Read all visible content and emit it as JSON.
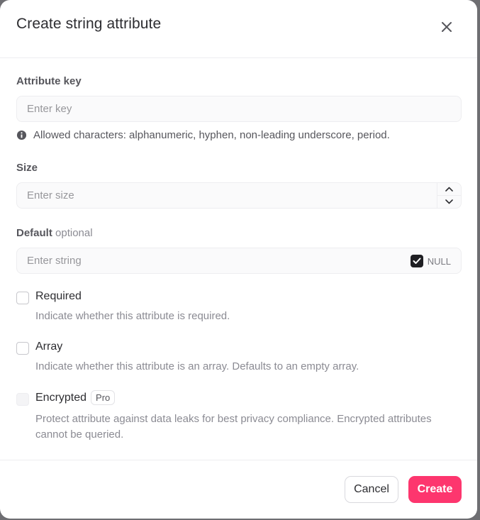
{
  "modal": {
    "title": "Create string attribute",
    "close_icon": "close-icon"
  },
  "key_field": {
    "label": "Attribute key",
    "placeholder": "Enter key",
    "value": "",
    "hint_icon": "info-icon",
    "hint": "Allowed characters: alphanumeric, hyphen, non-leading underscore, period."
  },
  "size_field": {
    "label": "Size",
    "placeholder": "Enter size",
    "value": "",
    "increment_icon": "chevron-up-icon",
    "decrement_icon": "chevron-down-icon"
  },
  "default_field": {
    "label": "Default",
    "optional": "optional",
    "placeholder": "Enter string",
    "value": "",
    "null_label": "NULL",
    "null_checked": true
  },
  "options": {
    "required": {
      "label": "Required",
      "description": "Indicate whether this attribute is required.",
      "checked": false
    },
    "array": {
      "label": "Array",
      "description": "Indicate whether this attribute is an array. Defaults to an empty array.",
      "checked": false
    },
    "encrypted": {
      "label": "Encrypted",
      "badge": "Pro",
      "description": "Protect attribute against data leaks for best privacy compliance. Encrypted attributes cannot be queried.",
      "checked": false,
      "disabled": true
    }
  },
  "footer": {
    "cancel_label": "Cancel",
    "create_label": "Create"
  },
  "colors": {
    "accent": "#fd366e",
    "backdrop": "#6e6e72",
    "text_primary": "#2d2d31",
    "text_muted": "#8b8b93"
  }
}
